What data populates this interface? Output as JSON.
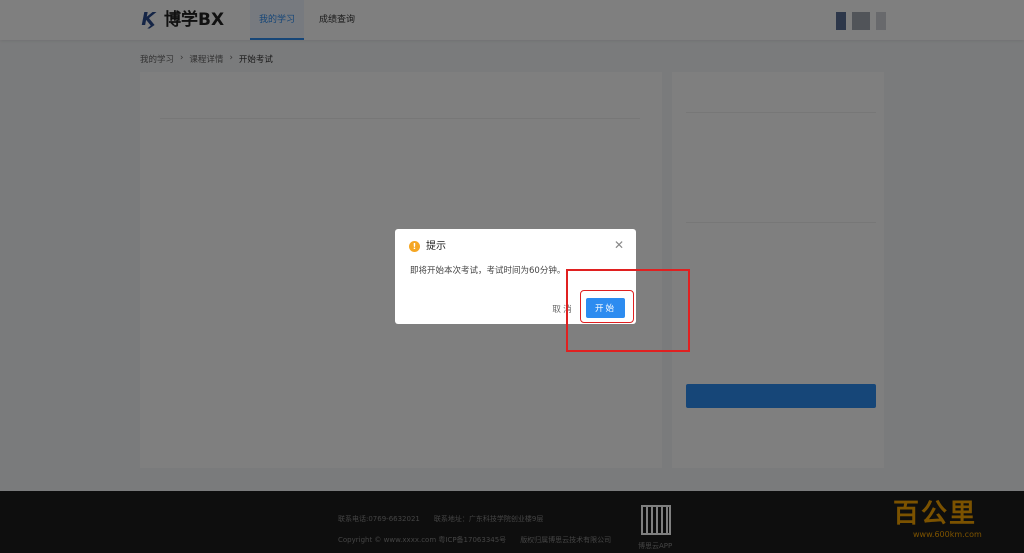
{
  "header": {
    "logo_text": "博学BX",
    "nav": [
      {
        "label": "我的学习",
        "active": true
      },
      {
        "label": "成绩查询",
        "active": false
      }
    ]
  },
  "breadcrumb": {
    "items": [
      "我的学习",
      "课程详情",
      "开始考试"
    ]
  },
  "footer": {
    "phone": "联系电话:0769-6632021",
    "address": "联系地址：广东科技学院创业楼9层",
    "copyright": "Copyright © www.xxxx.com 粤ICP备17063345号",
    "rights": "版权归属博思云技术有限公司",
    "app_label": "博思云APP"
  },
  "watermark": {
    "main": "百公里",
    "sub": "www.600km.com"
  },
  "dialog": {
    "icon": "warning-icon",
    "title": "提示",
    "message": "即将开始本次考试，考试时间为60分钟。",
    "cancel_label": "取 消",
    "start_label": "开始"
  },
  "colors": {
    "primary": "#2d8cf0",
    "warning": "#f5a623",
    "highlight": "#e02020",
    "footer_bg": "#1c1c1c"
  }
}
